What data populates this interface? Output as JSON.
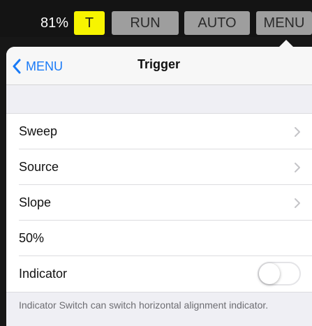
{
  "toolbar": {
    "zoom": "81%",
    "trigger_label": "T",
    "run_label": "RUN",
    "auto_label": "AUTO",
    "menu_label": "MENU",
    "trigger_color": "#f7f400"
  },
  "popover": {
    "back_label": "MENU",
    "title": "Trigger",
    "rows": [
      {
        "label": "Sweep",
        "accessory": "chevron-right-icon"
      },
      {
        "label": "Source",
        "accessory": "chevron-right-icon"
      },
      {
        "label": "Slope",
        "accessory": "chevron-right-icon"
      },
      {
        "label": "50%",
        "accessory": "none"
      },
      {
        "label": "Indicator",
        "accessory": "toggle",
        "value": false
      }
    ],
    "footer": "Indicator Switch can switch horizontal alignment indicator."
  },
  "colors": {
    "accent": "#1a7bf7",
    "toolbar_bg": "#141414",
    "button_gray": "#9e9e9e"
  }
}
